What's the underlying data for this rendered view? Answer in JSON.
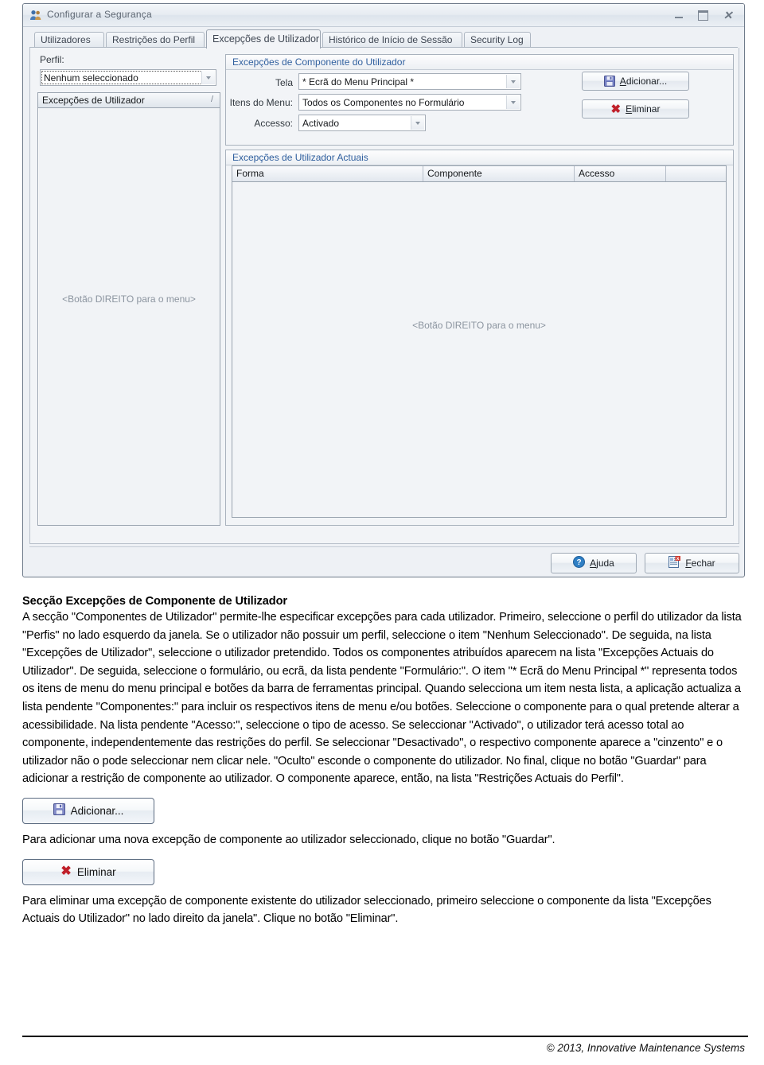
{
  "window": {
    "title": "Configurar a Segurança",
    "icon": "users-icon",
    "controls": {
      "minimize": "minimize-icon",
      "maximize": "maximize-icon",
      "close": "close-icon"
    },
    "tabs": [
      {
        "label": "Utilizadores",
        "active": false
      },
      {
        "label": "Restrições do Perfil",
        "active": false
      },
      {
        "label": "Excepções de Utilizador",
        "active": true
      },
      {
        "label": "Histórico de Início de Sessão",
        "active": false
      },
      {
        "label": "Security Log",
        "active": false
      }
    ],
    "left": {
      "perfil_label": "Perfil:",
      "perfil_value": "Nenhum seleccionado",
      "list_header": "Excepções de Utilizador",
      "list_header_split": "/",
      "list_hint": "<Botão DIREITO para o menu>"
    },
    "component_group": {
      "title": "Excepções de Componente do Utilizador",
      "fields": [
        {
          "label": "Tela",
          "value": "* Ecrã do Menu Principal *"
        },
        {
          "label": "Itens do Menu:",
          "value": "Todos os Componentes no Formulário"
        },
        {
          "label": "Accesso:",
          "value": "Activado"
        }
      ],
      "buttons": [
        {
          "label": "Adicionar...",
          "underline": "A",
          "icon": "save-disk-icon"
        },
        {
          "label": "Eliminar",
          "underline": "E",
          "icon": "red-x-icon"
        }
      ]
    },
    "current_group": {
      "title": "Excepções de Utilizador Actuais",
      "columns": [
        "Forma",
        "Componente",
        "Accesso"
      ],
      "rows": [],
      "hint": "<Botão DIREITO para o menu>"
    },
    "footer_buttons": [
      {
        "label": "Ajuda",
        "underline": "A",
        "icon": "help-icon"
      },
      {
        "label": "Fechar",
        "underline": "F",
        "icon": "close-window-icon"
      }
    ]
  },
  "document": {
    "heading": "Secção Excepções de Componente de Utilizador",
    "body": "A secção \"Componentes de Utilizador\" permite-lhe especificar excepções para cada utilizador. Primeiro, seleccione o perfil do utilizador da lista \"Perfis\" no lado esquerdo da janela. Se o utilizador não possuir um perfil, seleccione o item \"Nenhum Seleccionado\". De seguida, na lista \"Excepções de Utilizador\", seleccione o utilizador pretendido. Todos os componentes atribuídos aparecem na lista \"Excepções Actuais do Utilizador\". De seguida, seleccione o formulário, ou ecrã, da lista pendente \"Formulário:\". O item \"* Ecrã do Menu Principal *\" representa todos os itens de menu do menu principal e botões da barra de ferramentas principal. Quando selecciona um item nesta lista, a aplicação actualiza a lista pendente \"Componentes:\" para incluir os respectivos itens de menu e/ou botões. Seleccione o componente para o qual pretende alterar a acessibilidade. Na lista pendente \"Acesso:\", seleccione o tipo de acesso. Se seleccionar \"Activado\", o utilizador terá acesso total ao componente, independentemente das restrições do perfil. Se seleccionar \"Desactivado\", o respectivo componente aparece a \"cinzento\" e o utilizador não o pode seleccionar nem clicar nele. \"Oculto\" esconde o componente do utilizador. No final, clique no botão \"Guardar\" para adicionar a restrição de componente ao utilizador. O componente aparece, então, na lista \"Restrições Actuais do Perfil\".",
    "add_button": {
      "label": "Adicionar...",
      "icon": "save-disk-icon"
    },
    "add_text": "Para adicionar uma nova excepção de componente ao utilizador seleccionado, clique no botão \"Guardar\".",
    "delete_button": {
      "label": "Eliminar",
      "icon": "red-x-icon"
    },
    "delete_text": "Para eliminar uma excepção de componente existente do utilizador seleccionado, primeiro seleccione o componente da lista \"Excepções Actuais do Utilizador\" no lado direito da janela\". Clique no botão \"Eliminar\".",
    "copyright": "© 2013, Innovative Maintenance Systems"
  }
}
